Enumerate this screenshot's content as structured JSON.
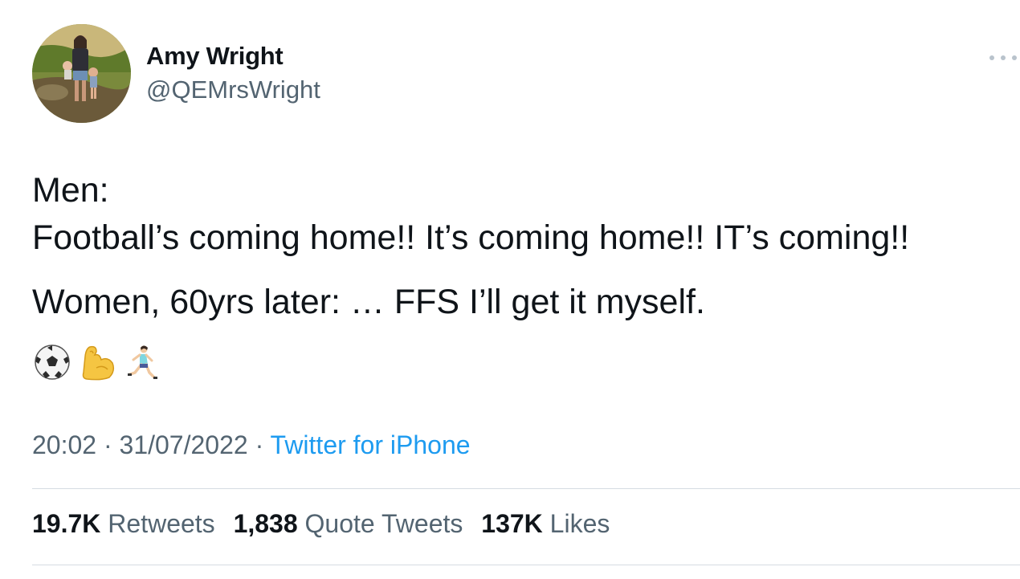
{
  "author": {
    "display_name": "Amy Wright",
    "handle": "@QEMrsWright"
  },
  "tweet": {
    "line1": "Men:",
    "line2": "Football’s coming home!! It’s coming home!! IT’s coming!!",
    "line3": "Women, 60yrs later: … FFS I’ll get it myself.",
    "emojis": [
      "soccer-ball-icon",
      "flexed-biceps-icon",
      "woman-running-icon"
    ]
  },
  "meta": {
    "time": "20:02",
    "separator": " · ",
    "date": "31/07/2022",
    "source": "Twitter for iPhone"
  },
  "stats": {
    "retweets_count": "19.7K",
    "retweets_label": "Retweets",
    "quotes_count": "1,838",
    "quotes_label": "Quote Tweets",
    "likes_count": "137K",
    "likes_label": "Likes"
  },
  "colors": {
    "text": "#0f1419",
    "secondary": "#536471",
    "link": "#1d9bf0",
    "divider": "#d5dce2"
  }
}
